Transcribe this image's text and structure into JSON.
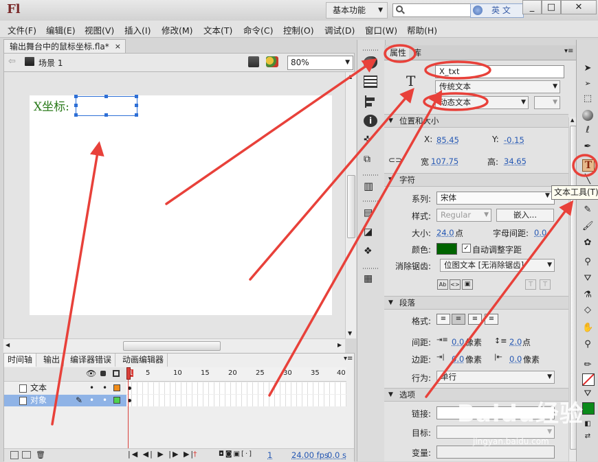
{
  "titlebar": {
    "logo": "Fl",
    "workspace": "基本功能",
    "ime_label": "英 文",
    "min_icon": "_",
    "max_icon": "□",
    "close_icon": "✕"
  },
  "menu": [
    "文件(F)",
    "编辑(E)",
    "视图(V)",
    "插入(I)",
    "修改(M)",
    "文本(T)",
    "命令(C)",
    "控制(O)",
    "调试(D)",
    "窗口(W)",
    "帮助(H)"
  ],
  "document": {
    "tab_label": "输出舞台中的鼠标坐标.fla*",
    "close_glyph": "×",
    "scene_label": "场景 1",
    "zoom": "80%"
  },
  "stage": {
    "static_text": "X坐标:",
    "text_color": "#2a7a1a"
  },
  "timeline": {
    "tabs": [
      "时间轴",
      "输出",
      "编译器错误",
      "动画编辑器"
    ],
    "ruler": [
      "1",
      "5",
      "10",
      "15",
      "20",
      "25",
      "30",
      "35",
      "40"
    ],
    "layers": [
      {
        "name": "文本",
        "color": "#f08c1a",
        "selected": false
      },
      {
        "name": "对象",
        "color": "#4fd24f",
        "selected": true
      }
    ],
    "status_frame": "1",
    "status_fps": "24.00 fps",
    "status_time": "0.0 s"
  },
  "props": {
    "tab_properties": "属性",
    "tab_library": "库",
    "instance_name": "X_txt",
    "text_engine": "传统文本",
    "text_type": "动态文本",
    "section_position": "位置和大小",
    "x_label": "X:",
    "x_value": "85.45",
    "y_label": "Y:",
    "y_value": "-0.15",
    "w_label": "宽",
    "w_value": "107.75",
    "h_label": "高:",
    "h_value": "34.65",
    "section_char": "字符",
    "family_label": "系列:",
    "family_value": "宋体",
    "style_label": "样式:",
    "style_value": "Regular",
    "embed_button": "嵌入...",
    "size_label": "大小:",
    "size_value": "24.0",
    "size_unit": "点",
    "spacing_label": "字母间距:",
    "spacing_value": "0.0",
    "color_label": "颜色:",
    "text_color": "#006400",
    "auto_kern": "自动调整字距",
    "aa_label": "消除锯齿:",
    "aa_value": "位图文本 [无消除锯齿]",
    "section_para": "段落",
    "format_label": "格式:",
    "spacing2_label": "间距:",
    "indent_value": "0.0",
    "indent_unit": "像素",
    "leading_value": "2.0",
    "leading_unit": "点",
    "margin_label": "边距:",
    "margin_left": "0.0",
    "margin_left_unit": "像素",
    "margin_right": "0.0",
    "margin_right_unit": "像素",
    "behavior_label": "行为:",
    "behavior_value": "单行",
    "section_options": "选项",
    "link_label": "链接:",
    "target_label": "目标:",
    "variable_label": "变量:"
  },
  "tools": {
    "tooltip": "文本工具(T)"
  },
  "watermark": {
    "logo": "Baidu经验",
    "url": "jingyan.baidu.com"
  },
  "colors": {
    "annotation": "#e8413a",
    "selection": "#2d6fd6"
  }
}
